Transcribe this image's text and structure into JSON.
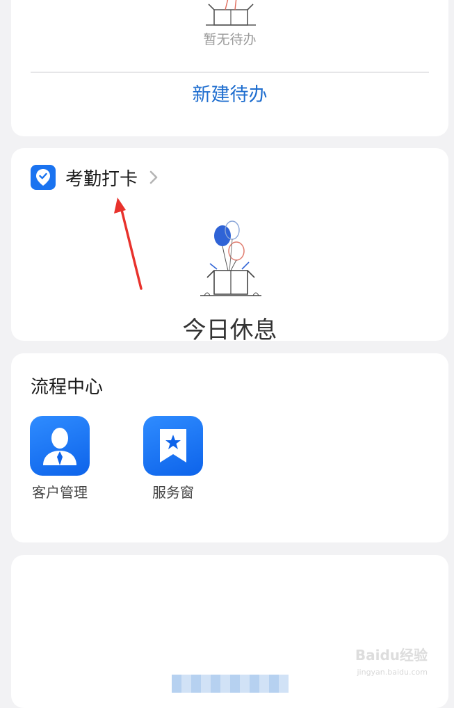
{
  "todo": {
    "empty_text": "暂无待办",
    "new_label": "新建待办"
  },
  "attendance": {
    "title": "考勤打卡",
    "status_text": "今日休息",
    "icon": "location-check-icon"
  },
  "process_center": {
    "title": "流程中心",
    "apps": [
      {
        "label": "客户管理",
        "icon": "customer-icon"
      },
      {
        "label": "服务窗",
        "icon": "bookmark-star-icon"
      }
    ]
  },
  "watermark": {
    "brand": "Baidu经验",
    "url": "jingyan.baidu.com"
  },
  "colors": {
    "accent": "#1f6ecf",
    "icon_blue": "#1a73f0",
    "annotation_arrow": "#e8322c"
  }
}
